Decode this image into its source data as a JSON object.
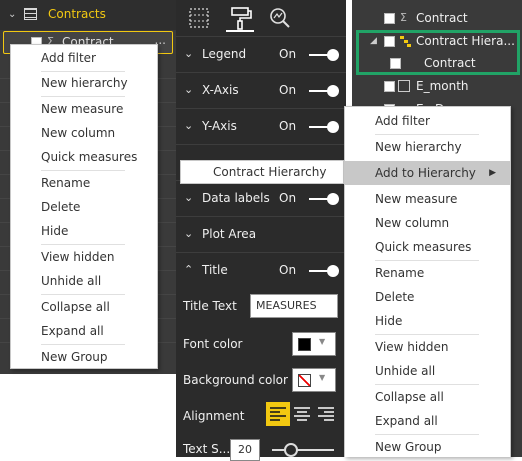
{
  "left_pane": {
    "table_name": "Contracts",
    "selected_field": "Contract",
    "more_glyph": "...",
    "menu_items": [
      "Add filter",
      "New hierarchy",
      "New measure",
      "New column",
      "Quick measures",
      "Rename",
      "Delete",
      "Hide",
      "View hidden",
      "Unhide all",
      "Collapse all",
      "Expand all",
      "New Group"
    ]
  },
  "format_pane": {
    "sections": [
      {
        "label": "Legend",
        "state": "On"
      },
      {
        "label": "X-Axis",
        "state": "On"
      },
      {
        "label": "Y-Axis",
        "state": "On"
      },
      {
        "label": "Data labels",
        "state": "On"
      },
      {
        "label": "Plot Area",
        "state": ""
      },
      {
        "label": "Title",
        "state": "On"
      }
    ],
    "title_text_label": "Title Text",
    "title_text_value": "MEASURES",
    "font_color_label": "Font color",
    "font_color": "#000000",
    "background_color_label": "Background color",
    "alignment_label": "Alignment",
    "alignment_selected": "left",
    "text_size_label": "Text S...",
    "text_size_value": "20",
    "text_size_fraction": 0.25
  },
  "submenu": {
    "item": "Contract Hierarchy"
  },
  "right_pane": {
    "rows": [
      {
        "label": "Contract",
        "type": "sigma"
      },
      {
        "label": "Contract Hiera...",
        "type": "hierarchy"
      },
      {
        "label": "Contract",
        "type": "child"
      },
      {
        "label": "E_month",
        "type": "calendar"
      },
      {
        "label": "E...D...",
        "type": "plain"
      }
    ],
    "menu_items": [
      "Add filter",
      "New hierarchy",
      "Add to Hierarchy",
      "New measure",
      "New column",
      "Quick measures",
      "Rename",
      "Delete",
      "Hide",
      "View hidden",
      "Unhide all",
      "Collapse all",
      "Expand all",
      "New Group"
    ],
    "hover_item": "Add to Hierarchy"
  },
  "colors": {
    "accent": "#f2c811",
    "highlight": "#21a366",
    "pane_bg": "#3a3a3a",
    "format_bg": "#2b2b2b"
  }
}
